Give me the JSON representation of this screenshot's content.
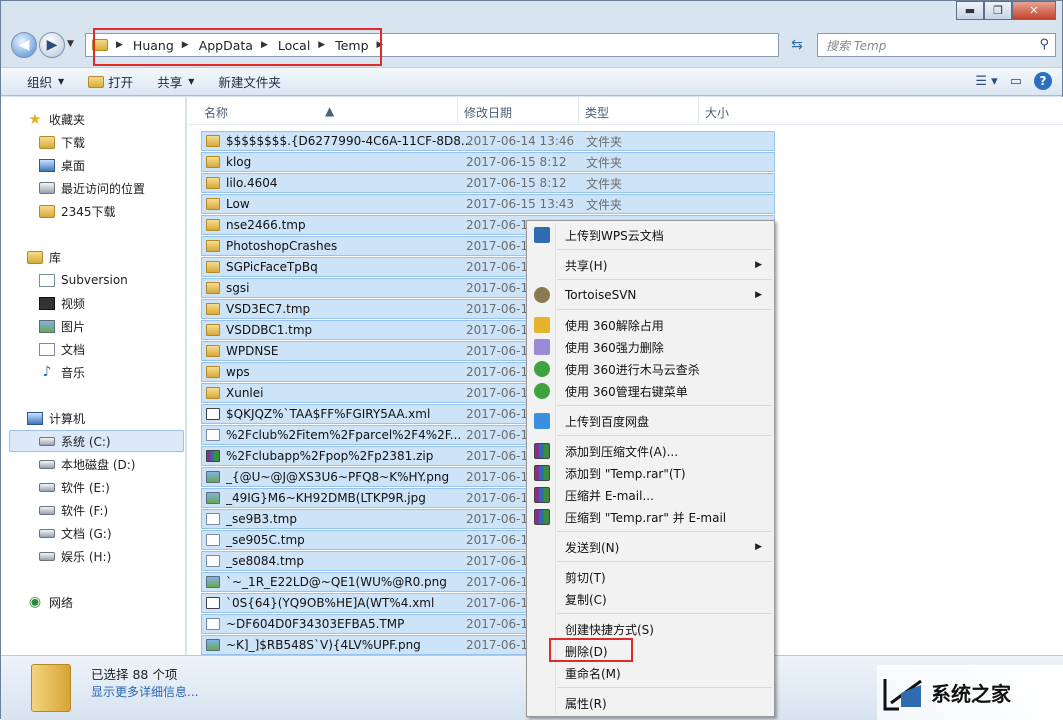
{
  "window": {
    "caption_min": "▬",
    "caption_max": "❐",
    "caption_close": "✕"
  },
  "address": {
    "crumbs": [
      "Huang",
      "AppData",
      "Local",
      "Temp"
    ],
    "search_placeholder": "搜索 Temp"
  },
  "toolbar": {
    "organize": "组织",
    "open": "打开",
    "share": "共享",
    "new_folder": "新建文件夹"
  },
  "sidebar": {
    "favorites": "收藏夹",
    "fav_items": [
      "下载",
      "桌面",
      "最近访问的位置",
      "2345下载"
    ],
    "libraries": "库",
    "lib_items": [
      "Subversion",
      "视频",
      "图片",
      "文档",
      "音乐"
    ],
    "computer": "计算机",
    "drives": [
      "系统 (C:)",
      "本地磁盘 (D:)",
      "软件 (E:)",
      "软件 (F:)",
      "文档 (G:)",
      "娱乐 (H:)"
    ],
    "network": "网络"
  },
  "columns": {
    "name": "名称",
    "date": "修改日期",
    "type": "类型",
    "size": "大小"
  },
  "files": [
    {
      "name": "$$$$$$$$.{D6277990-4C6A-11CF-8D8...",
      "date": "2017-06-14 13:46",
      "type": "文件夹",
      "icon": "folder-lock-icon"
    },
    {
      "name": "klog",
      "date": "2017-06-15 8:12",
      "type": "文件夹",
      "icon": "folder-lock-icon"
    },
    {
      "name": "lilo.4604",
      "date": "2017-06-15 8:12",
      "type": "文件夹",
      "icon": "folder-lock-icon"
    },
    {
      "name": "Low",
      "date": "2017-06-15 13:43",
      "type": "文件夹",
      "icon": "folder-lock-icon"
    },
    {
      "name": "nse2466.tmp",
      "date": "2017-06-1",
      "type": "",
      "icon": "folder-lock-icon"
    },
    {
      "name": "PhotoshopCrashes",
      "date": "2017-06-1",
      "type": "",
      "icon": "folder-lock-icon"
    },
    {
      "name": "SGPicFaceTpBq",
      "date": "2017-06-1",
      "type": "",
      "icon": "folder-icon"
    },
    {
      "name": "sgsi",
      "date": "2017-06-1",
      "type": "",
      "icon": "folder-lock-icon"
    },
    {
      "name": "VSD3EC7.tmp",
      "date": "2017-06-1",
      "type": "",
      "icon": "folder-lock-icon"
    },
    {
      "name": "VSDDBC1.tmp",
      "date": "2017-06-1",
      "type": "",
      "icon": "folder-lock-icon"
    },
    {
      "name": "WPDNSE",
      "date": "2017-06-1",
      "type": "",
      "icon": "folder-lock-icon"
    },
    {
      "name": "wps",
      "date": "2017-06-1",
      "type": "",
      "icon": "folder-lock-icon"
    },
    {
      "name": "Xunlei",
      "date": "2017-06-1",
      "type": "",
      "icon": "folder-lock-icon"
    },
    {
      "name": "$QKJQZ%`TAA$FF%FGIRY5AA.xml",
      "date": "2017-06-1",
      "type": "",
      "icon": "xml-file-icon"
    },
    {
      "name": "%2Fclub%2Fitem%2Fparcel%2F4%2F...",
      "date": "2017-06-1",
      "type": "",
      "icon": "file-lock-icon"
    },
    {
      "name": "%2Fclubapp%2Fpop%2Fp2381.zip",
      "date": "2017-06-1",
      "type": "",
      "icon": "zip-file-icon"
    },
    {
      "name": "_{@U~@J@XS3U6~PFQ8~K%HY.png",
      "date": "2017-06-1",
      "type": "",
      "icon": "image-file-icon"
    },
    {
      "name": "_49IG}M6~KH92DMB(LTKP9R.jpg",
      "date": "2017-06-1",
      "type": "",
      "icon": "image-file-icon"
    },
    {
      "name": "_se9B3.tmp",
      "date": "2017-06-1",
      "type": "",
      "icon": "file-lock-icon"
    },
    {
      "name": "_se905C.tmp",
      "date": "2017-06-1",
      "type": "",
      "icon": "file-lock-icon"
    },
    {
      "name": "_se8084.tmp",
      "date": "2017-06-1",
      "type": "",
      "icon": "file-lock-icon"
    },
    {
      "name": "`~_1R_E22LD@~QE1(WU%@R0.png",
      "date": "2017-06-1",
      "type": "",
      "icon": "image-file-icon"
    },
    {
      "name": "`0S{64}(YQ9OB%HE]A(WT%4.xml",
      "date": "2017-06-1",
      "type": "",
      "icon": "xml-file-icon"
    },
    {
      "name": "~DF604D0F34303EFBA5.TMP",
      "date": "2017-06-1",
      "type": "",
      "icon": "file-lock-icon"
    },
    {
      "name": "~K]_]$RB548S`V){4LV%UPF.png",
      "date": "2017-06-1",
      "type": "",
      "icon": "image-file-icon"
    }
  ],
  "context_menu": {
    "upload_wps": "上传到WPS云文档",
    "share": "共享(H)",
    "tortoise": "TortoiseSVN",
    "unlock_360": "使用 360解除占用",
    "force_delete_360": "使用 360强力删除",
    "trojan_scan_360": "使用 360进行木马云查杀",
    "manage_360": "使用 360管理右键菜单",
    "upload_baidu": "上传到百度网盘",
    "add_archive": "添加到压缩文件(A)...",
    "add_temp_rar": "添加到 \"Temp.rar\"(T)",
    "compress_email": "压缩并 E-mail...",
    "compress_temp_email": "压缩到 \"Temp.rar\" 并 E-mail",
    "send_to": "发送到(N)",
    "cut": "剪切(T)",
    "copy": "复制(C)",
    "create_shortcut": "创建快捷方式(S)",
    "delete": "删除(D)",
    "rename": "重命名(M)",
    "properties": "属性(R)"
  },
  "status": {
    "selected": "已选择 88 个项",
    "more_details": "显示更多详细信息..."
  },
  "watermark": {
    "text": "系统之家"
  },
  "colors": {
    "selection": "#cce3f8",
    "highlight_box": "#e02b2b",
    "link": "#2b66b3"
  }
}
